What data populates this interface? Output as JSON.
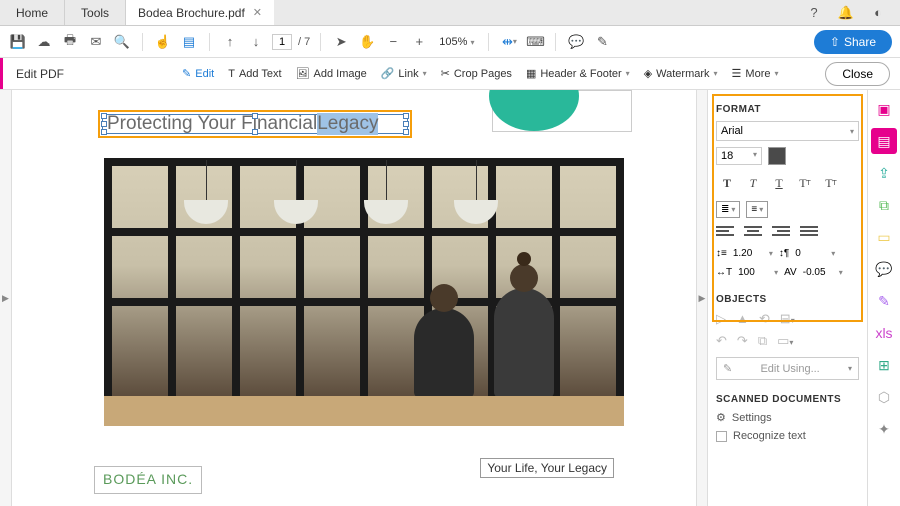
{
  "tabs": {
    "home": "Home",
    "tools": "Tools",
    "doc": "Bodea Brochure.pdf"
  },
  "toolbar": {
    "page_current": "1",
    "page_total": "/ 7",
    "zoom": "105%",
    "share": "Share"
  },
  "editbar": {
    "title": "Edit PDF",
    "edit": "Edit",
    "add_text": "Add Text",
    "add_image": "Add Image",
    "link": "Link",
    "crop": "Crop Pages",
    "header": "Header & Footer",
    "watermark": "Watermark",
    "more": "More",
    "close": "Close"
  },
  "document": {
    "heading_pre": "Protecting Your Financial ",
    "heading_sel": "Legacy",
    "footer_text": "Your Life, Your Legacy",
    "logo_text": "BODÉA INC."
  },
  "panel": {
    "format": "FORMAT",
    "font": "Arial",
    "size": "18",
    "line_height": "1.20",
    "para_spacing": "0",
    "hscale": "100",
    "tracking": "-0.05",
    "objects": "OBJECTS",
    "edit_using": "Edit Using...",
    "scanned": "SCANNED DOCUMENTS",
    "settings": "Settings",
    "recognize": "Recognize text"
  }
}
